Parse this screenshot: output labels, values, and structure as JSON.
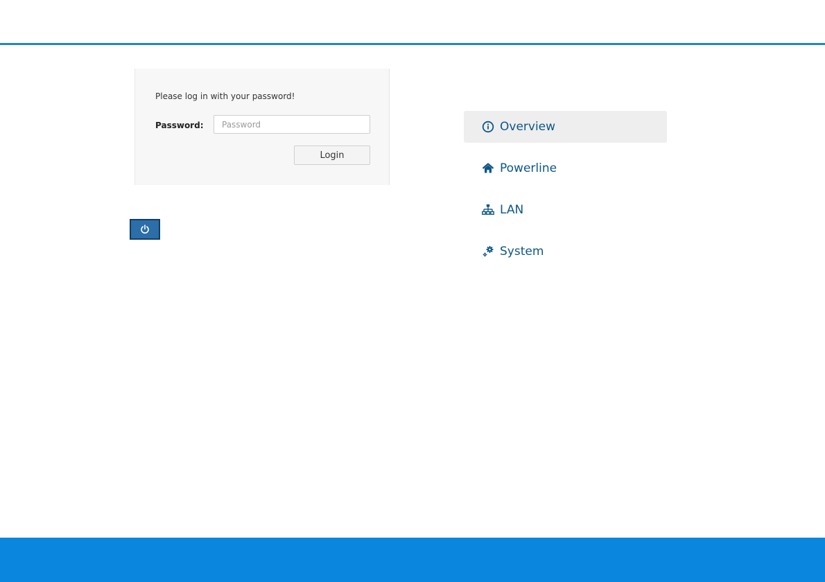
{
  "login": {
    "prompt": "Please log in with your password!",
    "password_label": "Password:",
    "password_placeholder": "Password",
    "password_value": "",
    "login_label": "Login"
  },
  "power_button": {
    "icon": "power-icon"
  },
  "nav": {
    "items": [
      {
        "label": "Overview",
        "icon": "info-circle-icon",
        "active": true
      },
      {
        "label": "Powerline",
        "icon": "home-icon",
        "active": false
      },
      {
        "label": "LAN",
        "icon": "network-icon",
        "active": false
      },
      {
        "label": "System",
        "icon": "gears-icon",
        "active": false
      }
    ]
  },
  "colors": {
    "accent": "#1f86d0",
    "footer": "#0a86df",
    "nav_text": "#0d5689",
    "power_button": "#2b6ea9"
  }
}
